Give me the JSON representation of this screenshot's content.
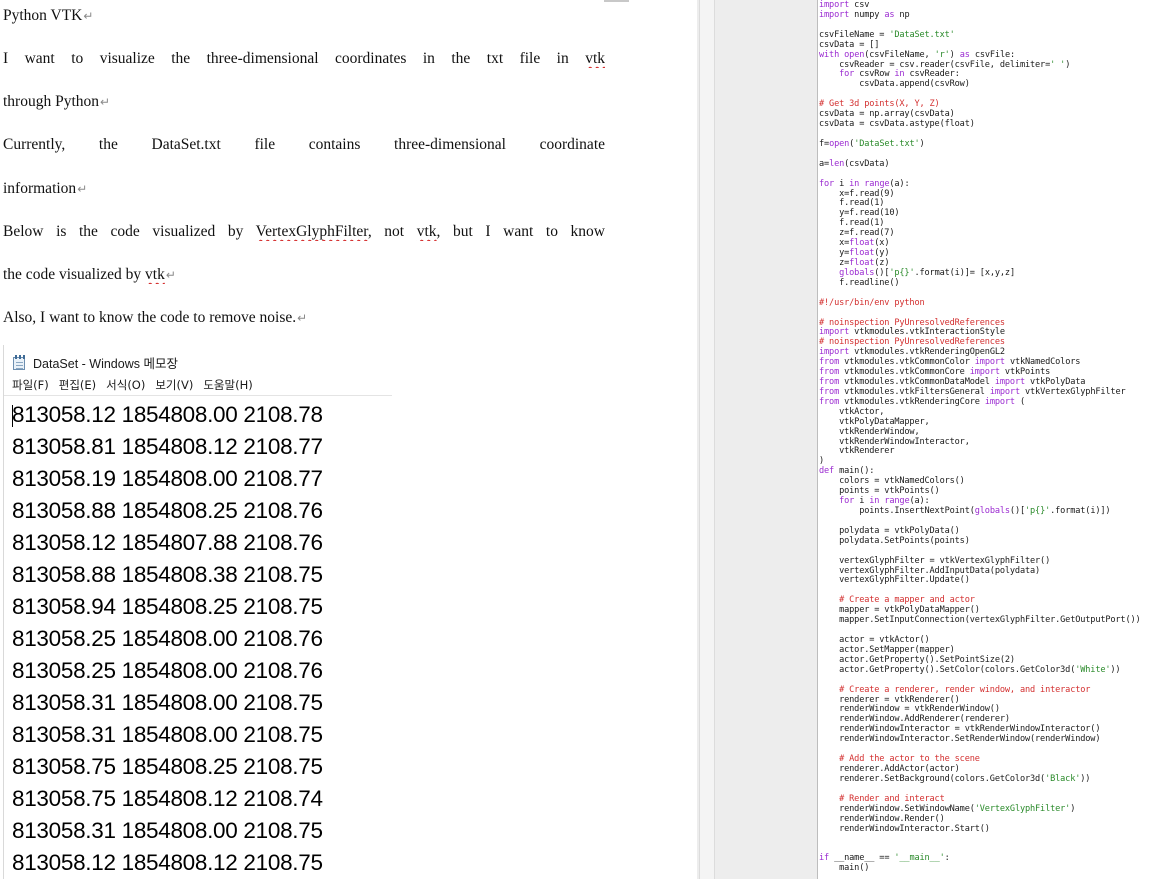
{
  "document": {
    "paragraphs": [
      "Python VTK",
      "I want to visualize the three-dimensional coordinates in the txt file in vtk",
      "through Python",
      "Currently, the DataSet.txt file contains three-dimensional coordinate",
      "information",
      "Below is the code visualized by VertexGlyphFilter, not vtk, but I want to know",
      "the code visualized by vtk",
      "Also, I want to know the code to remove noise."
    ]
  },
  "notepad": {
    "title": "DataSet - Windows 메모장",
    "icon": "notepad-icon",
    "menu": [
      "파일(F)",
      "편집(E)",
      "서식(O)",
      "보기(V)",
      "도움말(H)"
    ],
    "rows": [
      "813058.12 1854808.00 2108.78",
      "813058.81 1854808.12 2108.77",
      "813058.19 1854808.00 2108.77",
      "813058.88 1854808.25 2108.76",
      "813058.12 1854807.88 2108.76",
      "813058.88 1854808.38 2108.75",
      "813058.94 1854808.25 2108.75",
      "813058.25 1854808.00 2108.76",
      "813058.25 1854808.00 2108.76",
      "813058.31 1854808.00 2108.75",
      "813058.31 1854808.00 2108.75",
      "813058.75 1854808.25 2108.75",
      "813058.75 1854808.12 2108.74",
      "813058.31 1854808.00 2108.75",
      "813058.12 1854808.12 2108.75"
    ]
  },
  "code": {
    "lines": [
      "import csv",
      "import numpy as np",
      "",
      "csvFileName = 'DataSet.txt'",
      "csvData = []",
      "with open(csvFileName, 'r') as csvFile:",
      "    csvReader = csv.reader(csvFile, delimiter=' ')",
      "    for csvRow in csvReader:",
      "        csvData.append(csvRow)",
      "",
      "# Get 3d points(X, Y, Z)",
      "csvData = np.array(csvData)",
      "csvData = csvData.astype(float)",
      "",
      "f=open('DataSet.txt')",
      "",
      "a=len(csvData)",
      "",
      "for i in range(a):",
      "    x=f.read(9)",
      "    f.read(1)",
      "    y=f.read(10)",
      "    f.read(1)",
      "    z=f.read(7)",
      "    x=float(x)",
      "    y=float(y)",
      "    z=float(z)",
      "    globals()['p{}'.format(i)]= [x,y,z]",
      "    f.readline()",
      "",
      "#!/usr/bin/env python",
      "",
      "# noinspection PyUnresolvedReferences",
      "import vtkmodules.vtkInteractionStyle",
      "# noinspection PyUnresolvedReferences",
      "import vtkmodules.vtkRenderingOpenGL2",
      "from vtkmodules.vtkCommonColor import vtkNamedColors",
      "from vtkmodules.vtkCommonCore import vtkPoints",
      "from vtkmodules.vtkCommonDataModel import vtkPolyData",
      "from vtkmodules.vtkFiltersGeneral import vtkVertexGlyphFilter",
      "from vtkmodules.vtkRenderingCore import (",
      "    vtkActor,",
      "    vtkPolyDataMapper,",
      "    vtkRenderWindow,",
      "    vtkRenderWindowInteractor,",
      "    vtkRenderer",
      ")",
      "def main():",
      "    colors = vtkNamedColors()",
      "    points = vtkPoints()",
      "    for i in range(a):",
      "        points.InsertNextPoint(globals()['p{}'.format(i)])",
      "",
      "    polydata = vtkPolyData()",
      "    polydata.SetPoints(points)",
      "",
      "    vertexGlyphFilter = vtkVertexGlyphFilter()",
      "    vertexGlyphFilter.AddInputData(polydata)",
      "    vertexGlyphFilter.Update()",
      "",
      "    # Create a mapper and actor",
      "    mapper = vtkPolyDataMapper()",
      "    mapper.SetInputConnection(vertexGlyphFilter.GetOutputPort())",
      "",
      "    actor = vtkActor()",
      "    actor.SetMapper(mapper)",
      "    actor.GetProperty().SetPointSize(2)",
      "    actor.GetProperty().SetColor(colors.GetColor3d('White'))",
      "",
      "    # Create a renderer, render window, and interactor",
      "    renderer = vtkRenderer()",
      "    renderWindow = vtkRenderWindow()",
      "    renderWindow.AddRenderer(renderer)",
      "    renderWindowInteractor = vtkRenderWindowInteractor()",
      "    renderWindowInteractor.SetRenderWindow(renderWindow)",
      "",
      "    # Add the actor to the scene",
      "    renderer.AddActor(actor)",
      "    renderer.SetBackground(colors.GetColor3d('Black'))",
      "",
      "    # Render and interact",
      "    renderWindow.SetWindowName('VertexGlyphFilter')",
      "    renderWindow.Render()",
      "    renderWindowInteractor.Start()",
      "",
      "",
      "if __name__ == '__main__':",
      "    main()"
    ]
  },
  "colors": {
    "keyword": "#9b2bd1",
    "string": "#2a8a2a",
    "comment": "#d33030",
    "spellcheck": "#d11a1a"
  }
}
